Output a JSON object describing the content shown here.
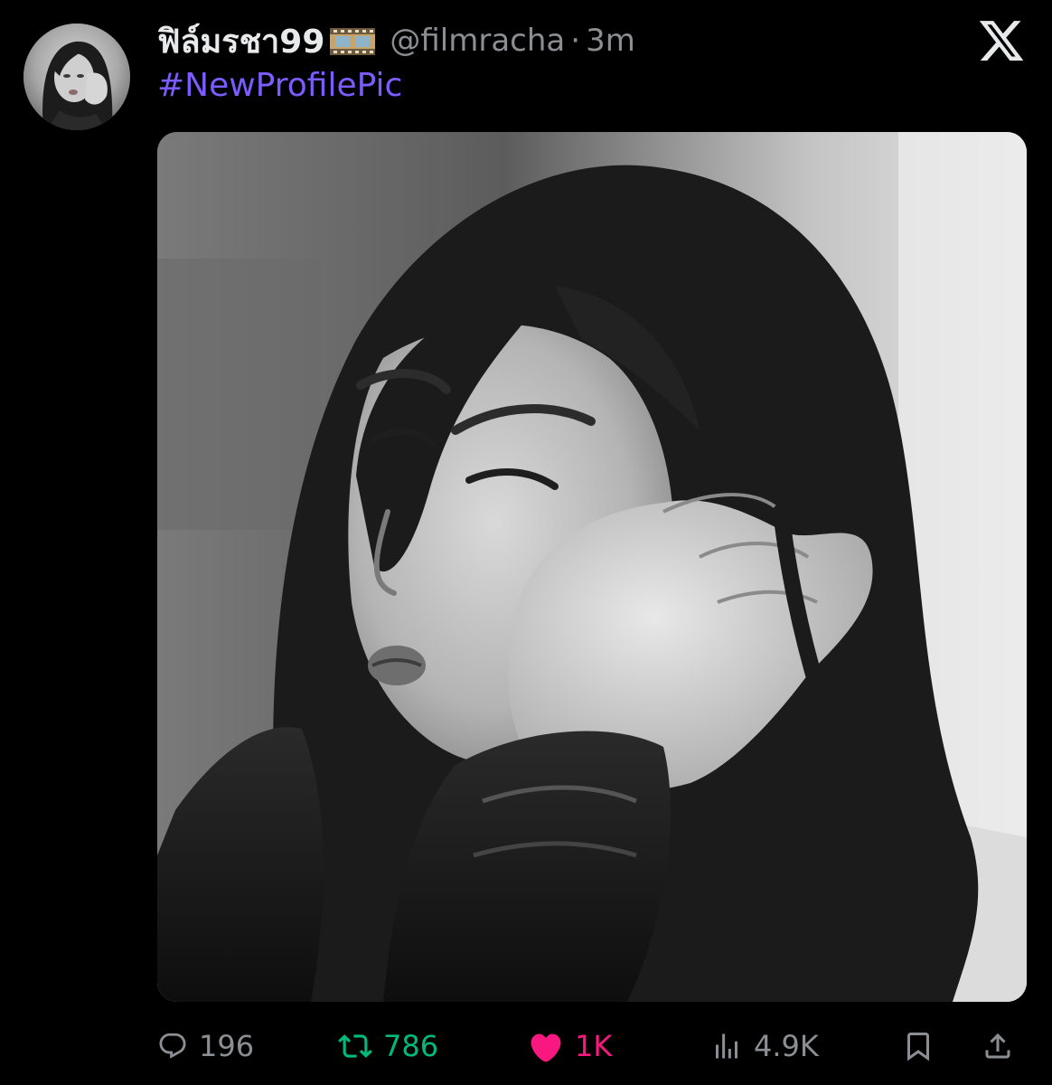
{
  "tweet": {
    "display_name": "ฟิล์มรชา99",
    "handle": "@filmracha",
    "separator": "·",
    "time": "3m",
    "text": "#NewProfilePic"
  },
  "icons": {
    "avatar": "profile-photo",
    "name_emoji": "film-frames-emoji",
    "logo": "x-logo-icon",
    "reply": "speech-bubble-icon",
    "retweet": "repost-arrows-icon",
    "like": "heart-icon",
    "views": "bar-chart-icon",
    "bookmark": "bookmark-icon",
    "share": "share-upload-icon"
  },
  "actions": {
    "replies": "196",
    "retweets": "786",
    "likes": "1K",
    "views": "4.9K"
  },
  "colors": {
    "background": "#000000",
    "hashtag": "#7c5cff",
    "retweet_active": "#00ba7c",
    "like_active": "#f91880",
    "muted": "#8b8f94"
  }
}
